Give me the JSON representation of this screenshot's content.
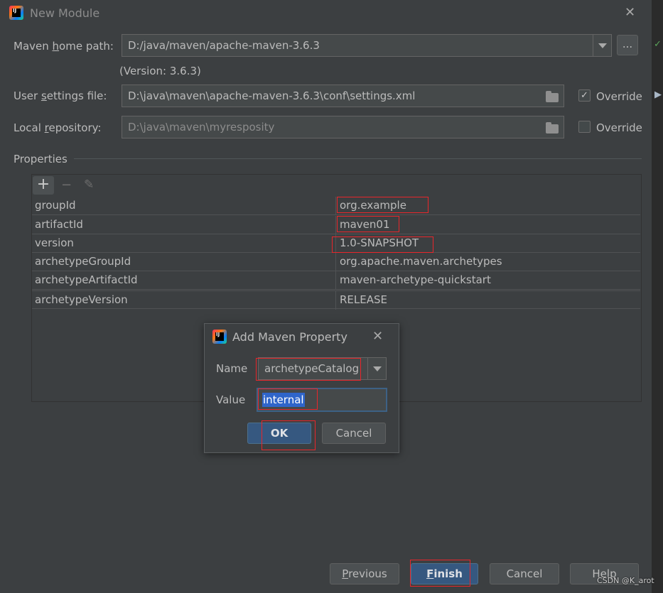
{
  "dialog": {
    "title": "New Module",
    "maven_home": {
      "label_pre": "Maven ",
      "label_mn": "h",
      "label_post": "ome path:",
      "value": "D:/java/maven/apache-maven-3.6.3",
      "browse": "...",
      "version_note": "(Version: 3.6.3)"
    },
    "user_settings": {
      "label_pre": "User ",
      "label_mn": "s",
      "label_post": "ettings file:",
      "value": "D:\\java\\maven\\apache-maven-3.6.3\\conf\\settings.xml",
      "override_label": "Override",
      "override_checked": true
    },
    "local_repo": {
      "label_pre": "Local ",
      "label_mn": "r",
      "label_post": "epository:",
      "value": "D:\\java\\maven\\myresposity",
      "override_label": "Override",
      "override_checked": false
    },
    "properties": {
      "header": "Properties",
      "toolbar": {
        "add": "+",
        "remove": "−",
        "edit": "✎"
      },
      "rows": [
        {
          "key": "groupId",
          "value": "org.example"
        },
        {
          "key": "artifactId",
          "value": "maven01"
        },
        {
          "key": "version",
          "value": "1.0-SNAPSHOT"
        },
        {
          "key": "archetypeGroupId",
          "value": "org.apache.maven.archetypes"
        },
        {
          "key": "archetypeArtifactId",
          "value": "maven-archetype-quickstart"
        },
        {
          "key": "archetypeVersion",
          "value": "RELEASE"
        }
      ]
    },
    "buttons": {
      "previous_mn": "P",
      "previous_rest": "revious",
      "finish_mn": "F",
      "finish_rest": "inish",
      "cancel": "Cancel",
      "help": "Help"
    }
  },
  "add_property": {
    "title": "Add Maven Property",
    "name_label": "Name",
    "name_value": "archetypeCatalog",
    "value_label": "Value",
    "value_value": "internal",
    "ok": "OK",
    "cancel": "Cancel"
  },
  "watermark": "CSDN @K_arot",
  "colors": {
    "accent": "#365880",
    "highlight": "#e8262b"
  }
}
